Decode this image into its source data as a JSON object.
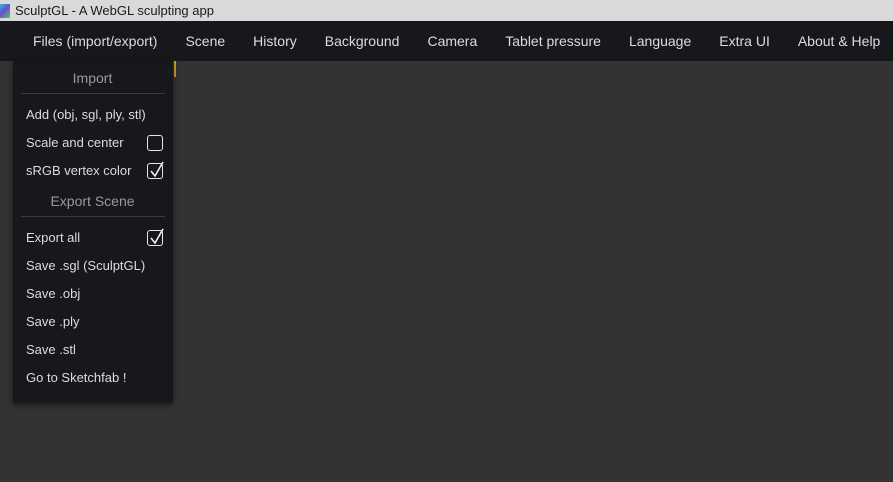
{
  "window": {
    "title": "SculptGL - A WebGL sculpting app"
  },
  "menubar": {
    "items": [
      "Files (import/export)",
      "Scene",
      "History",
      "Background",
      "Camera",
      "Tablet pressure",
      "Language",
      "Extra UI",
      "About & Help"
    ]
  },
  "files_menu": {
    "import_title": "Import",
    "add_label": "Add (obj, sgl, ply, stl)",
    "scale_center_label": "Scale and center",
    "scale_center_checked": false,
    "srgb_label": "sRGB vertex color",
    "srgb_checked": true,
    "export_title": "Export Scene",
    "export_all_label": "Export all",
    "export_all_checked": true,
    "save_sgl": "Save .sgl (SculptGL)",
    "save_obj": "Save .obj",
    "save_ply": "Save .ply",
    "save_stl": "Save .stl",
    "sketchfab": "Go to Sketchfab !"
  },
  "colors": {
    "menubar_bg": "#16181b",
    "canvas_bg": "#333333",
    "accent": "#d99a2b"
  }
}
